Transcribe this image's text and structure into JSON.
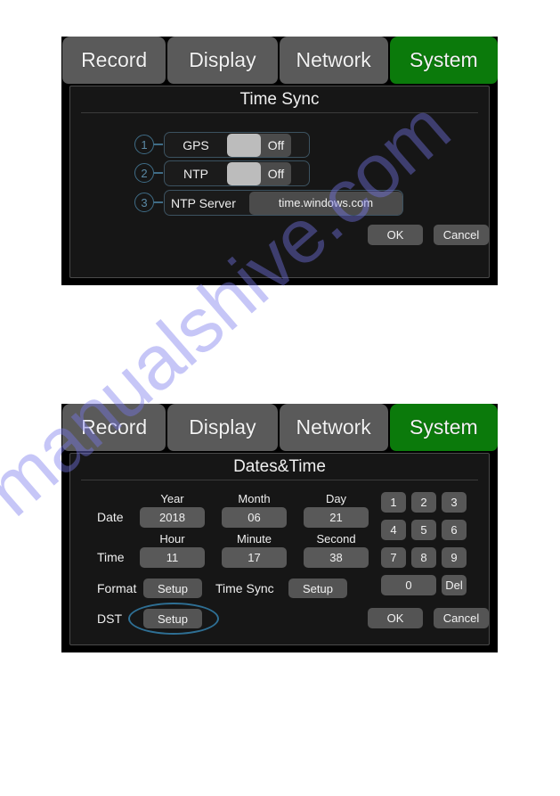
{
  "watermark": {
    "text": "manualshive.com"
  },
  "colors": {
    "tab_active": "#0b7a0b",
    "tab_inactive": "#5a5a5a",
    "panel_bg": "#161616",
    "callout": "#5b8aa6",
    "highlight": "#2e6f94"
  },
  "tabs": [
    {
      "label": "Record",
      "active": false
    },
    {
      "label": "Display",
      "active": false
    },
    {
      "label": "Network",
      "active": false
    },
    {
      "label": "System",
      "active": true
    }
  ],
  "time_sync_dialog": {
    "title": "Time Sync",
    "callouts": [
      "1",
      "2",
      "3"
    ],
    "rows": [
      {
        "label": "GPS",
        "state": "Off"
      },
      {
        "label": "NTP",
        "state": "Off"
      },
      {
        "label": "NTP Server",
        "value": "time.windows.com"
      }
    ],
    "buttons": {
      "ok": "OK",
      "cancel": "Cancel"
    }
  },
  "dates_time_dialog": {
    "title": "Dates&Time",
    "date_row": {
      "label": "Date",
      "headers": [
        "Year",
        "Month",
        "Day"
      ],
      "values": [
        "2018",
        "06",
        "21"
      ]
    },
    "time_row": {
      "label": "Time",
      "headers": [
        "Hour",
        "Minute",
        "Second"
      ],
      "values": [
        "11",
        "17",
        "38"
      ]
    },
    "format_row": {
      "label": "Format",
      "button": "Setup",
      "sync_label": "Time Sync",
      "sync_button": "Setup"
    },
    "dst_row": {
      "label": "DST",
      "button": "Setup"
    },
    "keypad": {
      "keys": [
        "1",
        "2",
        "3",
        "4",
        "5",
        "6",
        "7",
        "8",
        "9"
      ],
      "zero": "0",
      "del": "Del"
    },
    "buttons": {
      "ok": "OK",
      "cancel": "Cancel"
    }
  }
}
